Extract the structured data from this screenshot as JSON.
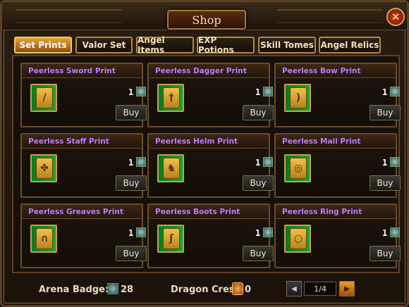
{
  "window": {
    "title": "Shop",
    "close_icon": "close-icon",
    "close_label": "✕"
  },
  "tabs": [
    {
      "label": "Set Prints",
      "active": true
    },
    {
      "label": "Valor Set",
      "active": false
    },
    {
      "label": "Angel Items",
      "active": false
    },
    {
      "label": "EXP Potions",
      "active": false
    },
    {
      "label": "Skill Tomes",
      "active": false
    },
    {
      "label": "Angel Relics",
      "active": false
    }
  ],
  "items": [
    {
      "name": "Peerless Sword Print",
      "qty": "1",
      "buy": "Buy",
      "icon": "sword-scroll-icon"
    },
    {
      "name": "Peerless Dagger Print",
      "qty": "1",
      "buy": "Buy",
      "icon": "dagger-scroll-icon"
    },
    {
      "name": "Peerless Bow Print",
      "qty": "1",
      "buy": "Buy",
      "icon": "bow-scroll-icon"
    },
    {
      "name": "Peerless Staff Print",
      "qty": "1",
      "buy": "Buy",
      "icon": "staff-scroll-icon"
    },
    {
      "name": "Peerless Helm Print",
      "qty": "1",
      "buy": "Buy",
      "icon": "helm-scroll-icon"
    },
    {
      "name": "Peerless Mail Print",
      "qty": "1",
      "buy": "Buy",
      "icon": "mail-scroll-icon"
    },
    {
      "name": "Peerless Greaves Print",
      "qty": "1",
      "buy": "Buy",
      "icon": "greaves-scroll-icon"
    },
    {
      "name": "Peerless Boots Print",
      "qty": "1",
      "buy": "Buy",
      "icon": "boots-scroll-icon"
    },
    {
      "name": "Peerless Ring Print",
      "qty": "1",
      "buy": "Buy",
      "icon": "ring-scroll-icon"
    }
  ],
  "footer": {
    "arena_badge_label": "Arena Badge:",
    "arena_badge_value": "28",
    "dragon_crest_label": "Dragon Crest",
    "dragon_crest_value": "0",
    "page": "1/4",
    "prev_icon": "prev-page-icon",
    "next_icon": "next-page-icon"
  },
  "colors": {
    "item_name": "#b77cff",
    "active_tab": "#e6a43a",
    "currency_gem": "#4a8a80"
  }
}
